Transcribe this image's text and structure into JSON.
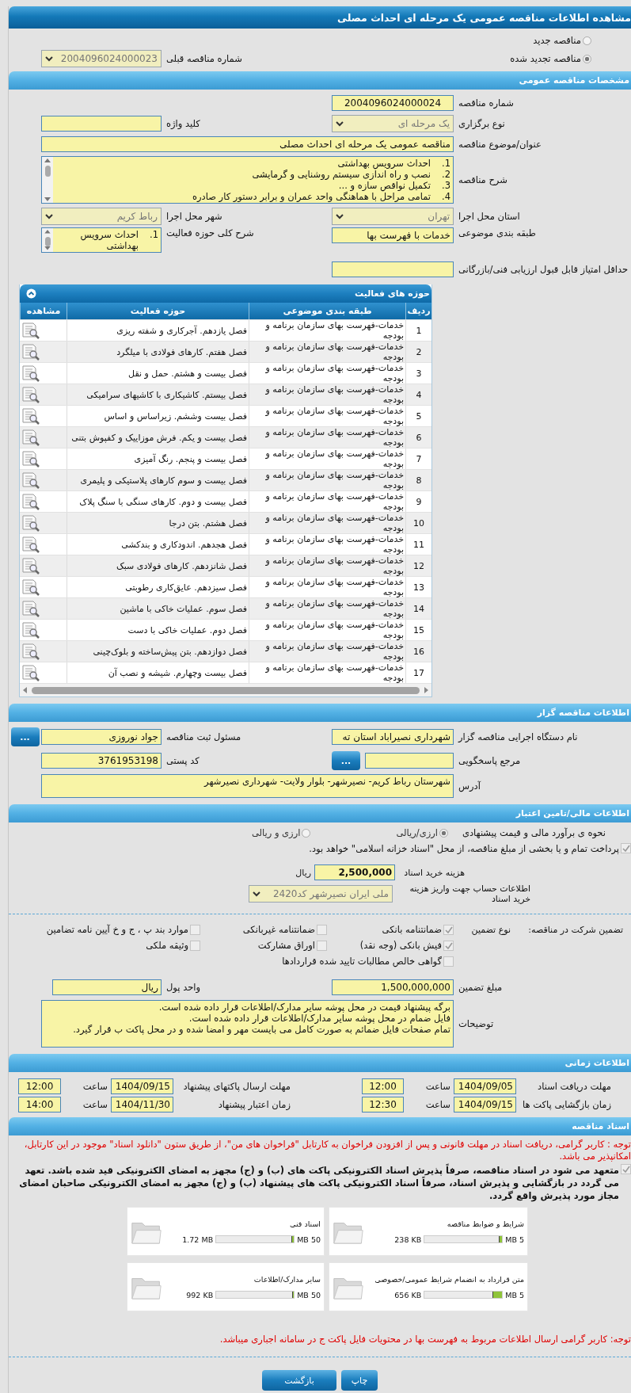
{
  "window": {
    "title": "مشاهده اطلاعات مناقصه عمومی یک مرحله ای احداث مصلی"
  },
  "tender_type": [
    {
      "label": "مناقصه جدید",
      "selected": false
    },
    {
      "label": "مناقصه تجدید شده",
      "selected": true
    }
  ],
  "previous_tender": {
    "label": "شماره مناقصه قبلی",
    "value": "2004096024000023"
  },
  "general": {
    "title": "مشخصات مناقصه عمومی",
    "tender_number": {
      "label": "شماره مناقصه",
      "value": "2004096024000024"
    },
    "holding_type": {
      "label": "نوع برگزاری",
      "value": "یک مرحله ای"
    },
    "keyword": {
      "label": "کلید واژه"
    },
    "subject": {
      "label": "عنوان/موضوع مناقصه",
      "value": "مناقصه عمومی یک مرحله ای احداث مصلی"
    },
    "description": {
      "label": "شرح مناقصه",
      "items": [
        {
          "number": "1.",
          "text": "احداث سرویس بهداشتی"
        },
        {
          "number": "2.",
          "text": "نصب و راه اندازی سیستم روشنایی و گرمایشی"
        },
        {
          "number": "3.",
          "text": "تکمیل نواقص سازه و ..."
        },
        {
          "number": "4.",
          "text": "تمامی مراحل با هماهنگی واحد عمران و برابر دستور کار صادره"
        }
      ]
    },
    "province": {
      "label": "استان محل اجرا",
      "value": "تهران"
    },
    "city": {
      "label": "شهر محل اجرا",
      "value": "رباط کریم"
    },
    "classification": {
      "label": "طبقه بندی موضوعی",
      "value": "خدمات با فهرست بها"
    },
    "activity_summary": {
      "label": "شرح کلی حوزه فعالیت",
      "items": [
        {
          "number": "1.",
          "text": "احداث سرویس بهداشتی"
        }
      ]
    },
    "min_score": {
      "label": "حداقل امتیاز قابل قبول ارزیابی فنی/بازرگانی"
    }
  },
  "activities": {
    "title": "حوزه های فعالیت",
    "expanded": true,
    "columns": [
      "ردیف",
      "طبقه بندی موضوعی",
      "حوزه فعالیت",
      "مشاهده"
    ],
    "rows": [
      {
        "number": "1",
        "category": "خدمات-فهرست بهای سازمان برنامه و بودجه",
        "activity": "فصل یازدهم. آجرکاری و شفته ریزی"
      },
      {
        "number": "2",
        "category": "خدمات-فهرست بهای سازمان برنامه و بودجه",
        "activity": "فصل هفتم. کارهای فولادی با میلگرد"
      },
      {
        "number": "3",
        "category": "خدمات-فهرست بهای سازمان برنامه و بودجه",
        "activity": "فصل بیست و هشتم. حمل و نقل"
      },
      {
        "number": "4",
        "category": "خدمات-فهرست بهای سازمان برنامه و بودجه",
        "activity": "فصل بیستم. کاشیکاری با کاشیهای سرامیکی"
      },
      {
        "number": "5",
        "category": "خدمات-فهرست بهای سازمان برنامه و بودجه",
        "activity": "فصل بیست وششم. زیراساس و اساس"
      },
      {
        "number": "6",
        "category": "خدمات-فهرست بهای سازمان برنامه و بودجه",
        "activity": "فصل بیست و یکم. فرش موزاییک و کفپوش بتنی"
      },
      {
        "number": "7",
        "category": "خدمات-فهرست بهای سازمان برنامه و بودجه",
        "activity": "فصل بیست و پنجم. رنگ آمیزی"
      },
      {
        "number": "8",
        "category": "خدمات-فهرست بهای سازمان برنامه و بودجه",
        "activity": "فصل بیست و سوم کارهای پلاستیکی و پلیمری"
      },
      {
        "number": "9",
        "category": "خدمات-فهرست بهای سازمان برنامه و بودجه",
        "activity": "فصل بیست و دوم. کارهای سنگی با سنگ پلاک"
      },
      {
        "number": "10",
        "category": "خدمات-فهرست بهای سازمان برنامه و بودجه",
        "activity": "فصل هشتم. بتن درجا"
      },
      {
        "number": "11",
        "category": "خدمات-فهرست بهای سازمان برنامه و بودجه",
        "activity": "فصل هجدهم. اندودکاری و بندکشی"
      },
      {
        "number": "12",
        "category": "خدمات-فهرست بهای سازمان برنامه و بودجه",
        "activity": "فصل شانزدهم. کارهای فولادی سبک"
      },
      {
        "number": "13",
        "category": "خدمات-فهرست بهای سازمان برنامه و بودجه",
        "activity": "فصل سیزدهم. عایق‌کاری رطوبتی"
      },
      {
        "number": "14",
        "category": "خدمات-فهرست بهای سازمان برنامه و بودجه",
        "activity": "فصل سوم. عملیات خاکی با ماشین"
      },
      {
        "number": "15",
        "category": "خدمات-فهرست بهای سازمان برنامه و بودجه",
        "activity": "فصل دوم. عملیات خاکی با دست"
      },
      {
        "number": "16",
        "category": "خدمات-فهرست بهای سازمان برنامه و بودجه",
        "activity": "فصل دوازدهم. بتن پیش‌ساخته و بلوک‌چینی"
      },
      {
        "number": "17",
        "category": "خدمات-فهرست بهای سازمان برنامه و بودجه",
        "activity": "فصل بیست وچهارم. شیشه و نصب آن"
      }
    ]
  },
  "organizer": {
    "title": "اطلاعات مناقصه گزار",
    "agency": {
      "label": "نام دستگاه اجرایی مناقصه گزار",
      "value": "شهرداری نصیراباد استان ته"
    },
    "registrar": {
      "label": "مسئول ثبت مناقصه",
      "value": "جواد نوروزی",
      "button": "..."
    },
    "reference": {
      "label": "مرجع پاسخگویی",
      "button": "..."
    },
    "postal_code": {
      "label": "کد پستی",
      "value": "3761953198"
    },
    "address": {
      "label": "آدرس",
      "value": "شهرستان رباط کریم- نصیرشهر- بلوار ولایت- شهرداری نصیرشهر"
    }
  },
  "finance": {
    "title": "اطلاعات مالی/تامین اعتبار",
    "estimate": {
      "label": "نحوه ی برآورد مالی و قیمت پیشنهادی",
      "options": [
        {
          "label": "ارزی/ریالی",
          "selected": true
        },
        {
          "label": "ارزی و ریالی",
          "selected": false
        }
      ]
    },
    "treasury": {
      "label": "پرداخت تمام و یا بخشی از مبلغ مناقصه، از محل \"اسناد خزانه اسلامی\" خواهد بود.",
      "checked": true
    },
    "document_cost": {
      "label": "هزینه خرید اسناد",
      "value": "2,500,000",
      "unit": "ریال"
    },
    "account": {
      "label": "اطلاعات حساب جهت واریز هزینه خرید اسناد",
      "value": "ملی ایران نصیرشهر کد2420"
    },
    "guarantee": {
      "label": "تضمین شرکت در مناقصه:",
      "type_label": "نوع تضمین",
      "options": [
        {
          "label": "ضمانتنامه بانکی",
          "checked": true
        },
        {
          "label": "ضمانتنامه غیربانکی",
          "checked": false
        },
        {
          "label": "موارد بند پ ، ج و خ آیین نامه تضامین",
          "checked": false
        },
        {
          "label": "فیش بانکی (وجه نقد)",
          "checked": true
        },
        {
          "label": "اوراق مشارکت",
          "checked": false
        },
        {
          "label": "وثیقه ملکی",
          "checked": false
        },
        {
          "label": "گواهی خالص مطالبات تایید شده قراردادها",
          "checked": false
        }
      ]
    },
    "amount": {
      "label": "مبلغ تضمین",
      "value": "1,500,000,000"
    },
    "currency": {
      "label": "واحد پول",
      "value": "ریال"
    },
    "notes": {
      "label": "توضیحات",
      "lines": [
        "برگه پیشنهاد قیمت در محل پوشه سایر مدارک/اطلاعات قرار داده شده است.",
        "فایل ضمام در محل پوشه سایر مدارک/اطلاعات قرار داده شده است.",
        "تمام صفحات فایل ضمائم به صورت کامل می بایست مهر و امضا شده و در محل پاکت ب قرار گیرد."
      ]
    }
  },
  "timing": {
    "title": "اطلاعات زمانی",
    "items": [
      {
        "label": "مهلت دریافت اسناد",
        "date": "1404/09/05",
        "time_label": "ساعت",
        "time": "12:00"
      },
      {
        "label": "مهلت ارسال پاکتهای پیشنهاد",
        "date": "1404/09/15",
        "time_label": "ساعت",
        "time": "12:00"
      },
      {
        "label": "زمان بازگشایی پاکت ها",
        "date": "1404/09/15",
        "time_label": "ساعت",
        "time": "12:30"
      },
      {
        "label": "زمان اعتبار پیشنهاد",
        "date": "1404/11/30",
        "time_label": "ساعت",
        "time": "14:00"
      }
    ]
  },
  "documents": {
    "title": "اسناد مناقصه",
    "notice": "توجه : کاربر گرامی، دریافت اسناد در مهلت قانونی و پس از افزودن فراخوان به کارتابل \"فراخوان های من\"، از طریق ستون \"دانلود اسناد\" موجود در این کارتابل، امکانپذیر می باشد.",
    "commitment": {
      "text": "متعهد می شود در اسناد مناقصه، صرفاً پذیرش اسناد الکترونیکی پاکت های (ب) و (ج) مجهز به امضای الکترونیکی قید شده باشد. تعهد می گردد در بازگشایی و پذیرش اسناد، صرفاً اسناد الکترونیکی پاکت های پیشنهاد (ب) و (ج) مجهز به امضای الکترونیکی صاحبان امضای مجاز مورد پذیرش واقع گردد.",
      "checked": true
    },
    "files": [
      {
        "title": "شرایط و ضوابط مناقصه",
        "max": "5 MB",
        "size": "238 KB",
        "level": 0.046
      },
      {
        "title": "اسناد فنی",
        "max": "50 MB",
        "size": "1.72 MB",
        "level": 0.034
      },
      {
        "title": "متن قرارداد به انضمام شرایط عمومی/خصوصی",
        "max": "5 MB",
        "size": "656 KB",
        "level": 0.128
      },
      {
        "title": "سایر مدارک/اطلاعات",
        "max": "50 MB",
        "size": "992 KB",
        "level": 0.019
      }
    ],
    "warning": "توجه: کاربر گرامی ارسال اطلاعات مربوط به فهرست بها در محتویات فایل پاکت ج در سامانه اجباری میباشد."
  },
  "buttons": [
    "چاپ",
    "بازگشت"
  ]
}
